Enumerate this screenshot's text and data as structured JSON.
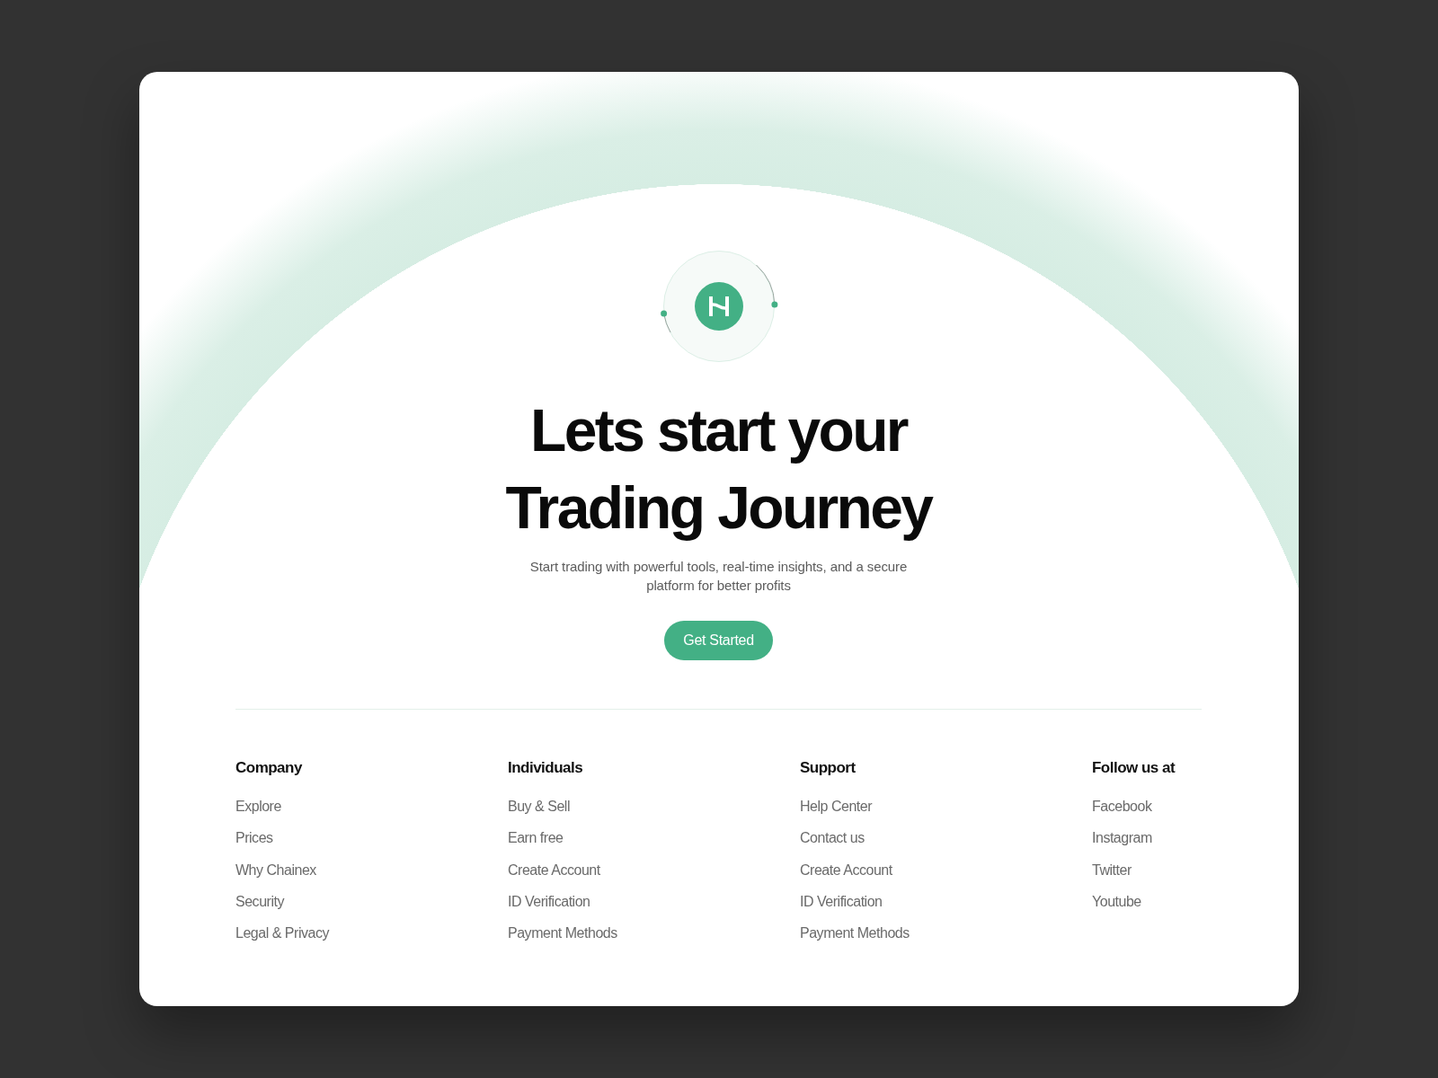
{
  "hero": {
    "title": "Lets start your Trading Journey",
    "subtitle": "Start trading with powerful tools, real-time insights, and a secure platform for better profits",
    "cta": "Get Started"
  },
  "footer": {
    "columns": [
      {
        "heading": "Company",
        "links": [
          "Explore",
          "Prices",
          "Why Chainex",
          "Security",
          "Legal & Privacy"
        ]
      },
      {
        "heading": "Individuals",
        "links": [
          "Buy & Sell",
          "Earn free",
          "Create Account",
          "ID Verification",
          "Payment Methods"
        ]
      },
      {
        "heading": "Support",
        "links": [
          "Help Center",
          "Contact us",
          "Create Account",
          "ID Verification",
          "Payment Methods"
        ]
      },
      {
        "heading": "Follow us at",
        "links": [
          "Facebook",
          "Instagram",
          "Twitter",
          "Youtube"
        ]
      }
    ]
  }
}
